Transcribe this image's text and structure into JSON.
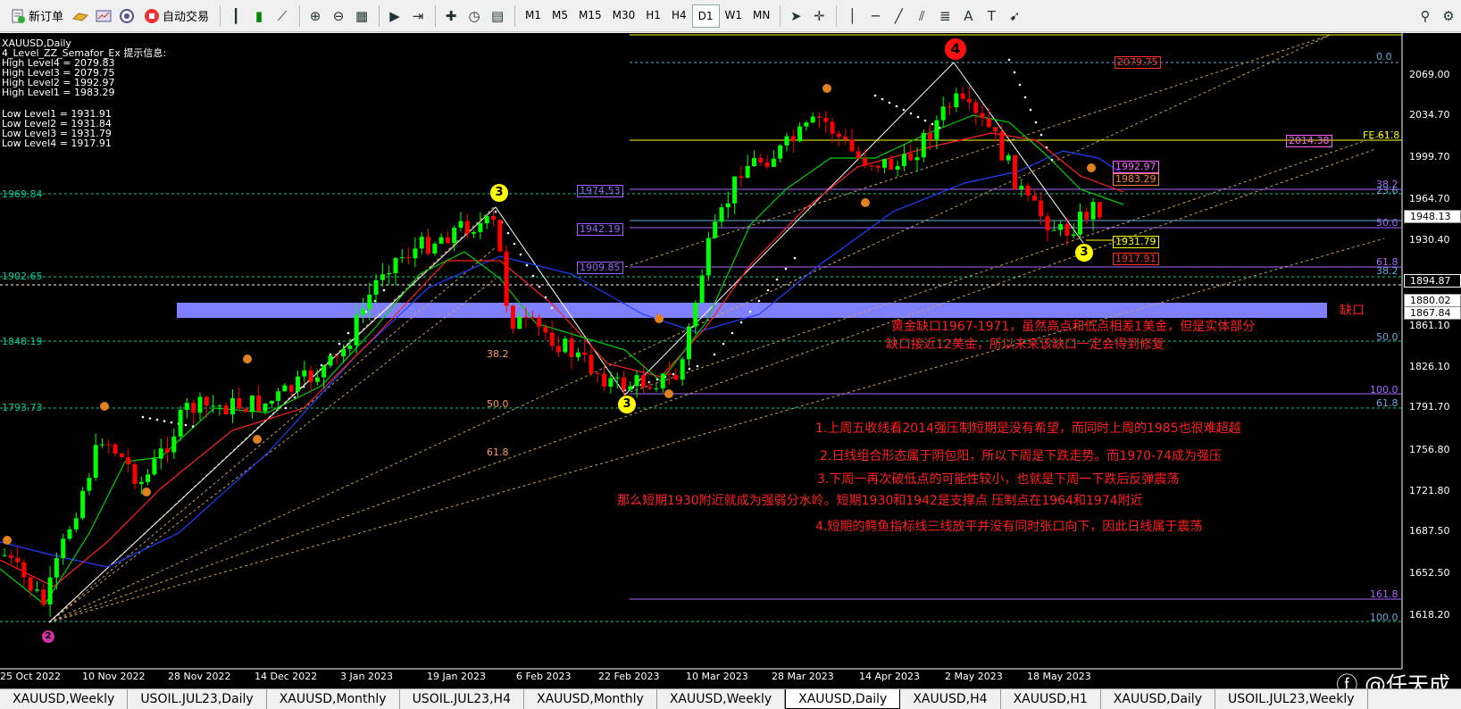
{
  "toolbar": {
    "new_order": "新订单",
    "auto_trade": "自动交易",
    "timeframes": [
      "M1",
      "M5",
      "M15",
      "M30",
      "H1",
      "H4",
      "D1",
      "W1",
      "MN"
    ],
    "active_timeframe": "D1"
  },
  "chart_info": {
    "symbol": "XAUUSD,Daily",
    "indicator": "4_Level_ZZ_Semafor_Ex 提示信息:",
    "high_levels": [
      "High Level4 = 2079.83",
      "High Level3 = 2079.75",
      "High Level2 = 1992.97",
      "High Level1 = 1983.29"
    ],
    "low_levels": [
      "Low Level1 = 1931.91",
      "Low Level2 = 1931.84",
      "Low Level3 = 1931.79",
      "Low Level4 = 1917.91"
    ]
  },
  "price_axis": [
    "2069.00",
    "2034.70",
    "1999.70",
    "1964.70",
    "1930.40",
    "1861.10",
    "1826.10",
    "1791.70",
    "1756.80",
    "1721.80",
    "1687.50",
    "1652.50",
    "1618.20"
  ],
  "price_axis_boxes": [
    {
      "label": "1948.13",
      "style": "white"
    },
    {
      "label": "1894.87",
      "style": "black"
    },
    {
      "label": "1880.02",
      "style": "white"
    },
    {
      "label": "1867.84",
      "style": "white"
    }
  ],
  "left_levels": [
    "1969.84",
    "1902.65",
    "1848.19",
    "1793.73"
  ],
  "level_boxes": [
    {
      "label": "2079.75",
      "color": "#ff3030"
    },
    {
      "label": "2014.38",
      "color": "#ff60ff"
    },
    {
      "label": "1992.97",
      "color": "#ff60ff"
    },
    {
      "label": "1983.29",
      "color": "#ff8040"
    },
    {
      "label": "1974.53",
      "color": "#a060ff"
    },
    {
      "label": "1942.19",
      "color": "#a060ff"
    },
    {
      "label": "1931.79",
      "color": "#ffff00"
    },
    {
      "label": "1917.91",
      "color": "#ff3030"
    },
    {
      "label": "1909.85",
      "color": "#a060ff"
    }
  ],
  "fib_right": [
    "0.0",
    "FE 61.8",
    "38.2",
    "23.6",
    "50.0",
    "61.8",
    "38.2",
    "50.0",
    "100.0",
    "61.8",
    "161.8",
    "100.0"
  ],
  "fib_left": [
    "38.2",
    "50.0",
    "61.8"
  ],
  "gap_label": "缺口",
  "notes": [
    "黄金缺口1967-1971，虽然高点和低点相差1美金，但是实体部分",
    "缺口接近12美金，所以未来该缺口一定会得到修复",
    "1.上周五收线看2014强压制短期是没有希望，而同时上周的1985也很难超越",
    "2.日线组合形态属于阴包阳，所以下周是下跌走势。而1970-74成为强压",
    "3.下周一再次破低点的可能性较小，也就是下周一下跌后反弹震荡",
    "那么短期1930附近就成为强弱分水岭。短期1930和1942是支撑点     压制点在1964和1974附近",
    "4.短期的鳄鱼指标线三线放平并没有同时张口向下，因此日线属于震荡"
  ],
  "semafor": [
    "4",
    "3",
    "3",
    "3",
    "2"
  ],
  "time_axis": [
    "25 Oct 2022",
    "10 Nov 2022",
    "28 Nov 2022",
    "14 Dec 2022",
    "3 Jan 2023",
    "19 Jan 2023",
    "6 Feb 2023",
    "22 Feb 2023",
    "10 Mar 2023",
    "28 Mar 2023",
    "14 Apr 2023",
    "2 May 2023",
    "18 May 2023"
  ],
  "watermark": "@任天成",
  "tabs": [
    "XAUUSD,Weekly",
    "USOIL.JUL23,Daily",
    "XAUUSD,Monthly",
    "USOIL.JUL23,H4",
    "XAUUSD,Monthly",
    "XAUUSD,Weekly",
    "XAUUSD,Daily",
    "XAUUSD,H4",
    "XAUUSD,H1",
    "XAUUSD,Daily",
    "USOIL.JUL23,Weekly"
  ],
  "active_tab": "XAUUSD,Daily",
  "colors": {
    "bull": "#00ff00",
    "bear": "#ff0000",
    "gap_zone": "#8080ff",
    "ma_green": "#00d000",
    "ma_red": "#ff2020",
    "ma_blue": "#2040ff"
  }
}
